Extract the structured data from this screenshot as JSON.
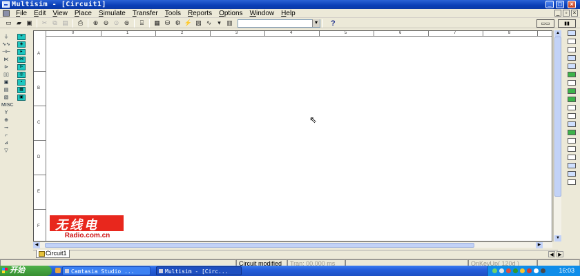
{
  "window": {
    "title": "Multisim - [Circuit1]"
  },
  "menu": [
    "File",
    "Edit",
    "View",
    "Place",
    "Simulate",
    "Transfer",
    "Tools",
    "Reports",
    "Options",
    "Window",
    "Help"
  ],
  "toolbar": {
    "help_label": "?",
    "combo_value": ""
  },
  "ruler": {
    "columns": [
      "0",
      "1",
      "2",
      "3",
      "4",
      "5",
      "6",
      "7",
      "8"
    ],
    "rows": [
      "A",
      "B",
      "C",
      "D",
      "E",
      "F"
    ]
  },
  "watermark": {
    "chinese": "无线电",
    "url": "Radio.com.cn"
  },
  "tabs": {
    "sheet": "Circuit1"
  },
  "status": {
    "message": "Circuit modified",
    "tran": "Tran: 00.000 ms",
    "onkey": "OnKeyUp( 120d )"
  },
  "taskbar": {
    "start": "开始",
    "tasks": [
      "Camtasia Studio ...",
      "Multisim - [Circ..."
    ],
    "clock": "16:03"
  },
  "colors": {
    "title_blue": "#0a3fb7",
    "chrome": "#ece9d8",
    "canvas": "#ffffff",
    "watermark_red": "#e8271d",
    "start_green": "#378f32",
    "taskbar_blue": "#245edb"
  }
}
